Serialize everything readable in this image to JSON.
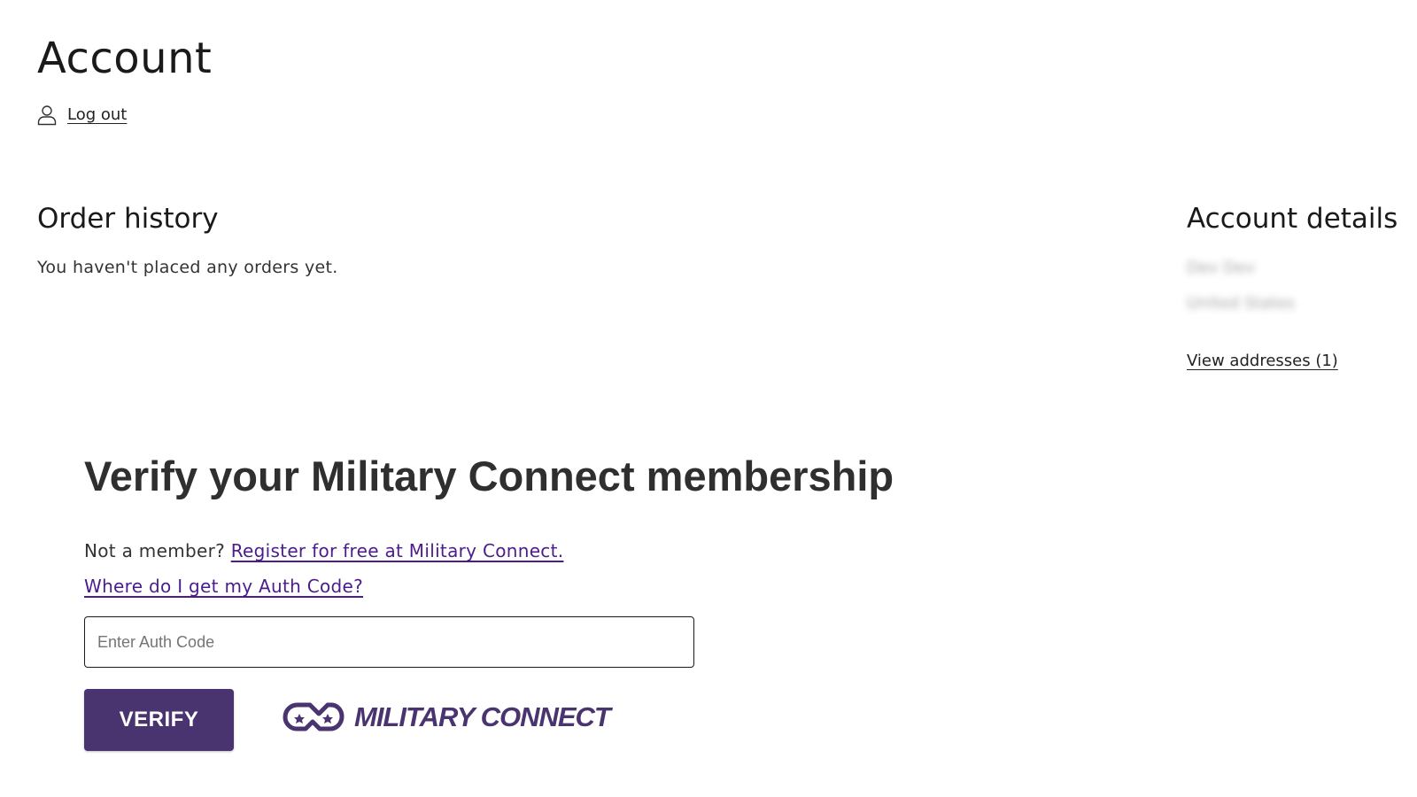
{
  "page": {
    "title": "Account",
    "logout_label": "Log out"
  },
  "order_history": {
    "heading": "Order history",
    "empty_message": "You haven't placed any orders yet."
  },
  "account_details": {
    "heading": "Account details",
    "name": "Dev Dev",
    "country": "United States",
    "view_addresses_label": "View addresses (1)"
  },
  "military_connect": {
    "title": "Verify your Military Connect membership",
    "not_member_text": "Not a member?",
    "register_link": "Register for free at Military Connect.",
    "auth_code_help_link": "Where do I get my Auth Code?",
    "auth_input_placeholder": "Enter Auth Code",
    "auth_input_value": "",
    "verify_button": "VERIFY",
    "logo_text": "MILITARY CONNECT"
  },
  "colors": {
    "brand_purple": "#4a3470",
    "link_purple": "#4b1c8c",
    "text": "#222222",
    "background": "#ffffff"
  },
  "icons": {
    "logout": "user-icon",
    "logo": "military-connect-logo-icon"
  }
}
